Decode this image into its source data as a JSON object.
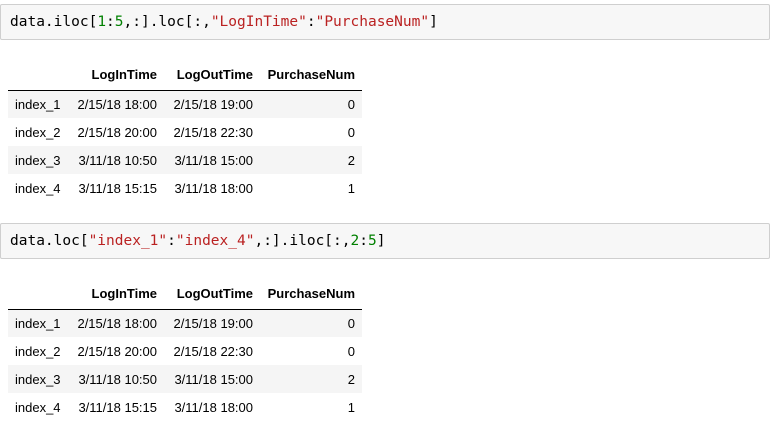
{
  "cells": [
    {
      "code_tokens": [
        {
          "t": "data.iloc[",
          "k": "plain"
        },
        {
          "t": "1",
          "k": "num"
        },
        {
          "t": ":",
          "k": "plain"
        },
        {
          "t": "5",
          "k": "num"
        },
        {
          "t": ",:].loc[:,",
          "k": "plain"
        },
        {
          "t": "\"LogInTime\"",
          "k": "str"
        },
        {
          "t": ":",
          "k": "plain"
        },
        {
          "t": "\"PurchaseNum\"",
          "k": "str"
        },
        {
          "t": "]",
          "k": "plain"
        }
      ],
      "table": {
        "columns": [
          "",
          "LogInTime",
          "LogOutTime",
          "PurchaseNum"
        ],
        "rows": [
          [
            "index_1",
            "2/15/18 18:00",
            "2/15/18 19:00",
            "0"
          ],
          [
            "index_2",
            "2/15/18 20:00",
            "2/15/18 22:30",
            "0"
          ],
          [
            "index_3",
            "3/11/18 10:50",
            "3/11/18 15:00",
            "2"
          ],
          [
            "index_4",
            "3/11/18 15:15",
            "3/11/18 18:00",
            "1"
          ]
        ]
      }
    },
    {
      "code_tokens": [
        {
          "t": "data.loc[",
          "k": "plain"
        },
        {
          "t": "\"index_1\"",
          "k": "str"
        },
        {
          "t": ":",
          "k": "plain"
        },
        {
          "t": "\"index_4\"",
          "k": "str"
        },
        {
          "t": ",:].iloc[:,",
          "k": "plain"
        },
        {
          "t": "2",
          "k": "num"
        },
        {
          "t": ":",
          "k": "plain"
        },
        {
          "t": "5",
          "k": "num"
        },
        {
          "t": "]",
          "k": "plain"
        }
      ],
      "table": {
        "columns": [
          "",
          "LogInTime",
          "LogOutTime",
          "PurchaseNum"
        ],
        "rows": [
          [
            "index_1",
            "2/15/18 18:00",
            "2/15/18 19:00",
            "0"
          ],
          [
            "index_2",
            "2/15/18 20:00",
            "2/15/18 22:30",
            "0"
          ],
          [
            "index_3",
            "3/11/18 10:50",
            "3/11/18 15:00",
            "2"
          ],
          [
            "index_4",
            "3/11/18 15:15",
            "3/11/18 18:00",
            "1"
          ]
        ]
      }
    }
  ],
  "colors": {
    "string_token": "#ba2121",
    "number_token": "#008000",
    "input_bg": "#f7f7f7",
    "stripe_row": "#f5f5f5"
  }
}
